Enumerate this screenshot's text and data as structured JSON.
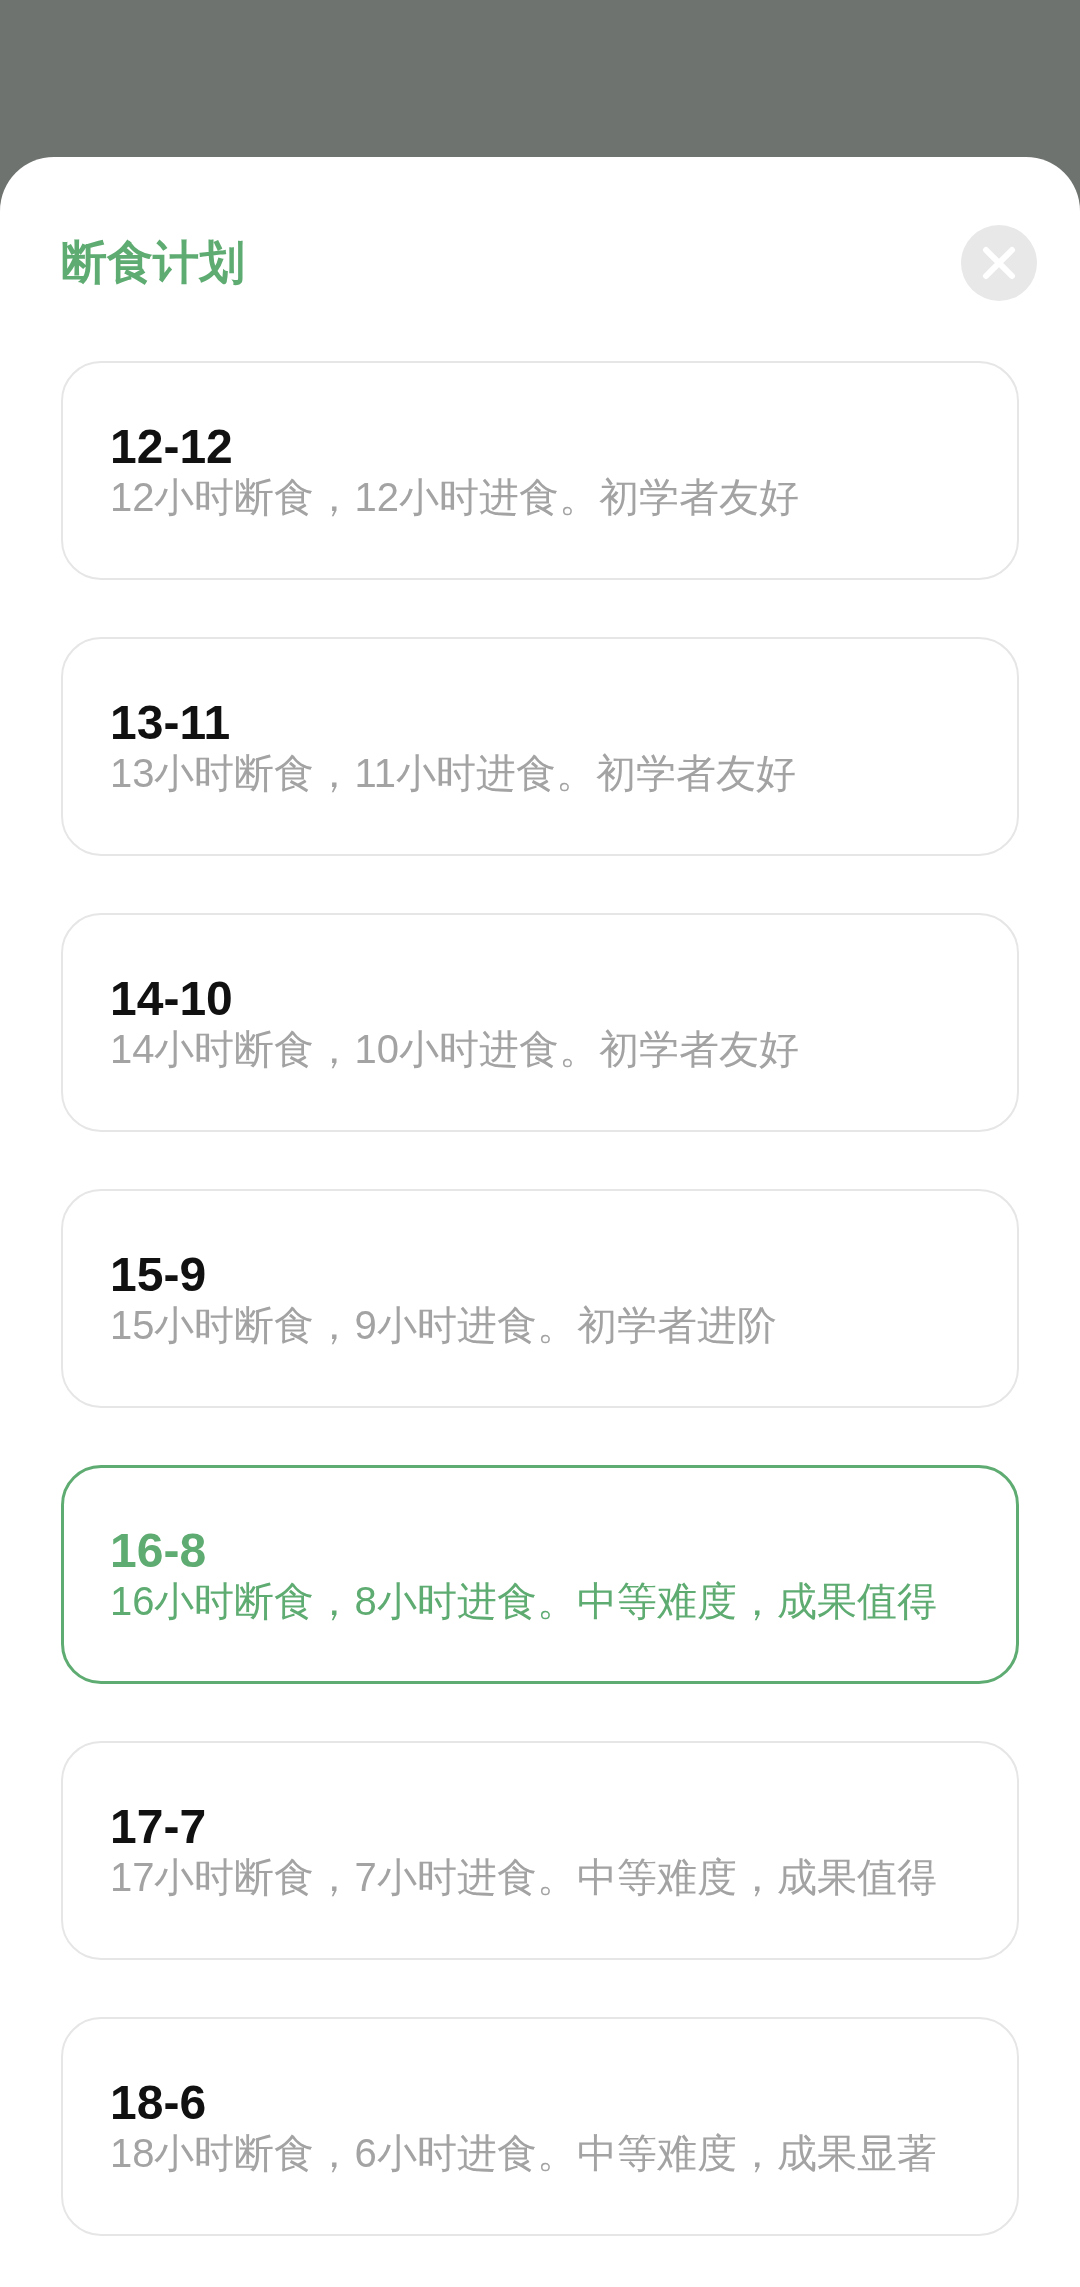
{
  "sheet": {
    "title": "断食计划"
  },
  "plans": [
    {
      "name": "12-12",
      "description": "12小时断食，12小时进食。初学者友好",
      "selected": false
    },
    {
      "name": "13-11",
      "description": "13小时断食，11小时进食。初学者友好",
      "selected": false
    },
    {
      "name": "14-10",
      "description": "14小时断食，10小时进食。初学者友好",
      "selected": false
    },
    {
      "name": "15-9",
      "description": "15小时断食，9小时进食。初学者进阶",
      "selected": false
    },
    {
      "name": "16-8",
      "description": "16小时断食，8小时进食。中等难度，成果值得",
      "selected": true
    },
    {
      "name": "17-7",
      "description": "17小时断食，7小时进食。中等难度，成果值得",
      "selected": false
    },
    {
      "name": "18-6",
      "description": "18小时断食，6小时进食。中等难度，成果显著",
      "selected": false
    }
  ]
}
